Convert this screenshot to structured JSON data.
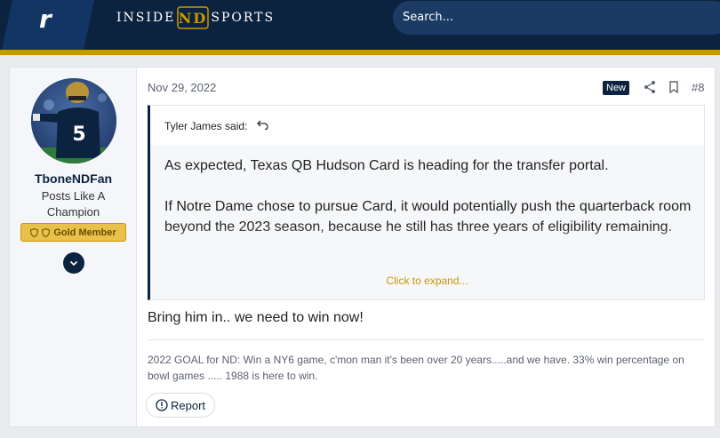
{
  "header": {
    "brand_letter": "r",
    "site_left": "INSIDE",
    "site_monogram": "ND",
    "site_right": "SPORTS",
    "search_placeholder": "Search..."
  },
  "post": {
    "user": {
      "username": "TboneNDFan",
      "title": "Posts Like A Champion",
      "badge": "Gold Member",
      "avatar_jersey_number": "5"
    },
    "date": "Nov 29, 2022",
    "new_badge": "New",
    "post_number": "#8",
    "quote": {
      "author": "Tyler James said:",
      "paragraph1": "As expected, Texas QB Hudson Card is heading for the transfer portal.",
      "paragraph2": "If Notre Dame chose to pursue Card, it would potentially push the quarterback room beyond the 2023 season, because he still has three years of eligibility remaining.",
      "expand_label": "Click to expand..."
    },
    "body": "Bring him in.. we need to win now!",
    "signature": "2022 GOAL for ND: Win a NY6 game, c'mon man it's been over 20 years.....and we have. 33% win percentage on bowl games ..... 1988 is here to win.",
    "report_label": "Report"
  },
  "colors": {
    "navy": "#0c2340",
    "gold": "#c99700",
    "background": "#e9ebee"
  },
  "icons": [
    "share-icon",
    "bookmark-icon",
    "reply-arrow-icon",
    "chevron-down-icon",
    "report-icon",
    "shield-icon"
  ]
}
